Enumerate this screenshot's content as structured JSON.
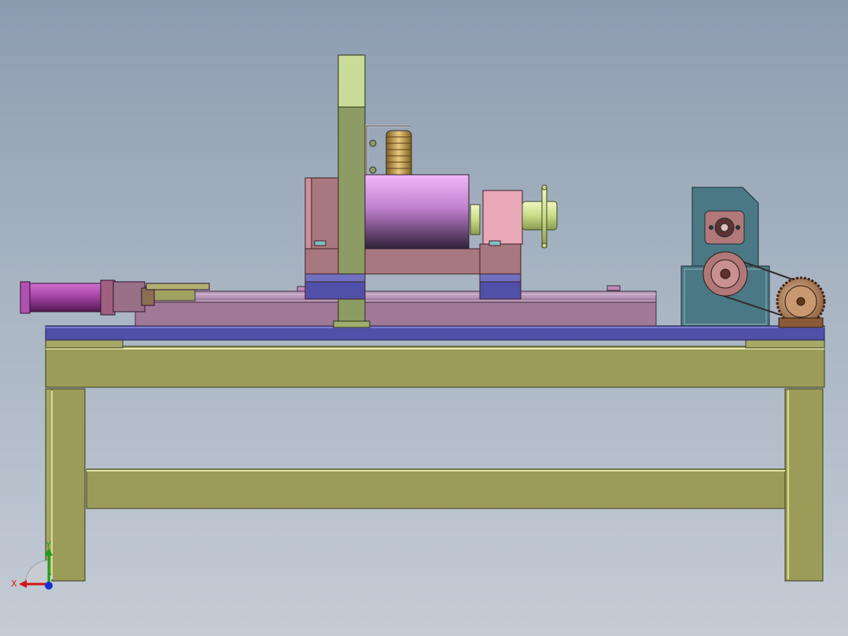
{
  "triad": {
    "x_label": "X",
    "y_label": "Y",
    "x_color": "#d01818",
    "y_color": "#18a018",
    "z_color": "#1830d0"
  },
  "colors": {
    "background_top": "#8c9cb0",
    "background_bottom": "#c4ccd5",
    "frame": "#9a9c58",
    "frame_highlight": "#d8dc98",
    "base_plate": "#5050a8",
    "slide_bed": "#a07898",
    "post": "#8c9c64",
    "headstock": "#a87880",
    "cylinder": "#c080d0",
    "motor": "#a040a0",
    "gearbox": "#4a7884",
    "pulley": "#b07878",
    "gear": "#b88c60",
    "spring": "#c0a060",
    "shaft": "#c8dc88"
  }
}
